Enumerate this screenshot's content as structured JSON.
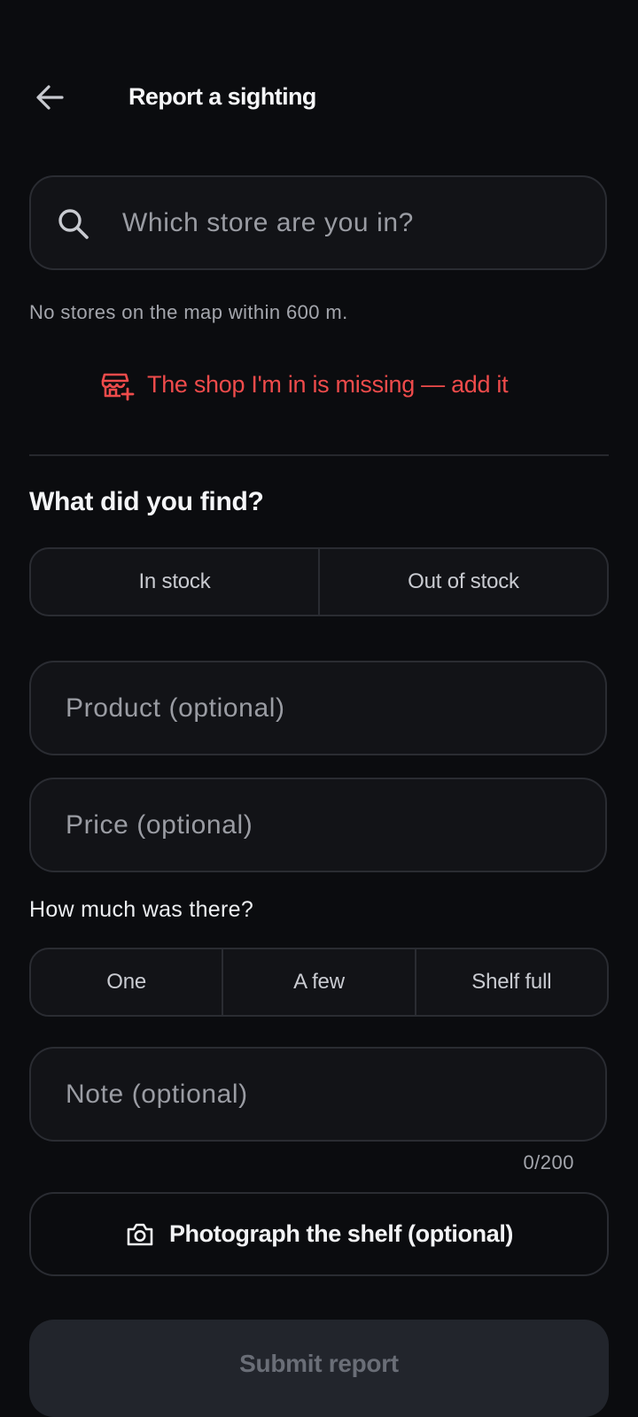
{
  "header": {
    "back_icon": "arrow-left-icon",
    "title": "Report a sighting"
  },
  "store_search": {
    "icon": "search-icon",
    "placeholder": "Which store are you in?",
    "value": ""
  },
  "store_hint": "No stores on the map within 600 m.",
  "add_store": {
    "icon": "store-add-icon",
    "label": "The shop I'm in is missing — add it",
    "color": "#ef4b4b"
  },
  "find_section": {
    "title": "What did you find?",
    "options": [
      "In stock",
      "Out of stock"
    ]
  },
  "product_field": {
    "placeholder": "Product (optional)",
    "value": ""
  },
  "price_field": {
    "placeholder": "Price (optional)",
    "value": ""
  },
  "amount_section": {
    "label": "How much was there?",
    "options": [
      "One",
      "A few",
      "Shelf full"
    ]
  },
  "note_field": {
    "placeholder": "Note (optional)",
    "value": "",
    "counter": "0/200"
  },
  "photo_button": {
    "icon": "camera-icon",
    "label": "Photograph the shelf (optional)"
  },
  "submit_button": {
    "label": "Submit report"
  }
}
